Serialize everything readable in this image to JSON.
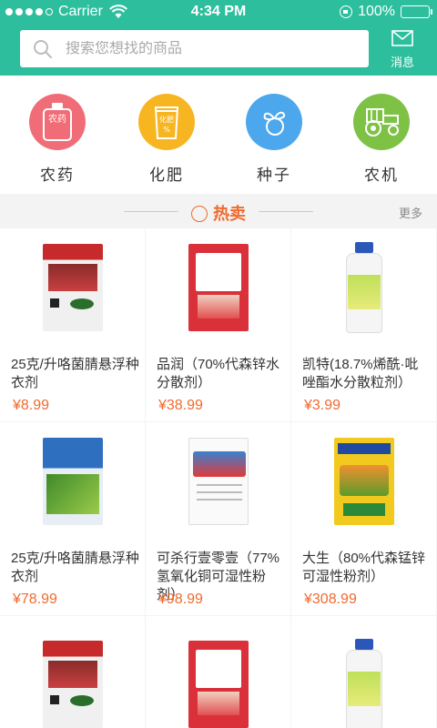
{
  "status_bar": {
    "carrier": "Carrier",
    "time": "4:34 PM",
    "battery": "100%"
  },
  "search": {
    "placeholder": "搜索您想找的商品",
    "icon": "search-icon"
  },
  "header": {
    "message_label": "消息",
    "message_icon": "envelope-icon"
  },
  "categories": [
    {
      "label": "农药",
      "icon_text": "农药",
      "color": "#f06d77"
    },
    {
      "label": "化肥",
      "icon_text": "化肥",
      "color": "#f7b522"
    },
    {
      "label": "种子",
      "icon_text": "",
      "color": "#4da7ec"
    },
    {
      "label": "农机",
      "icon_text": "",
      "color": "#7dc145"
    }
  ],
  "hot": {
    "title": "热卖",
    "more": "更多"
  },
  "products": [
    {
      "name": "25克/升咯菌腈悬浮种衣剂",
      "price": "¥8.99"
    },
    {
      "name": "品润（70%代森锌水分散剂）",
      "price": "¥38.99"
    },
    {
      "name": "凯特(18.7%烯酰·吡唑酯水分散粒剂）",
      "price": "¥3.99"
    },
    {
      "name": "25克/升咯菌腈悬浮种衣剂",
      "price": "¥78.99"
    },
    {
      "name": "可杀行壹零壹（77%氢氧化铜可湿性粉剂）",
      "price": "¥98.99"
    },
    {
      "name": "大生（80%代森锰锌可湿性粉剂）",
      "price": "¥308.99"
    },
    {
      "name": "",
      "price": ""
    },
    {
      "name": "",
      "price": ""
    },
    {
      "name": "",
      "price": ""
    }
  ],
  "colors": {
    "brand": "#2dbf9d",
    "price": "#f06a2e"
  }
}
